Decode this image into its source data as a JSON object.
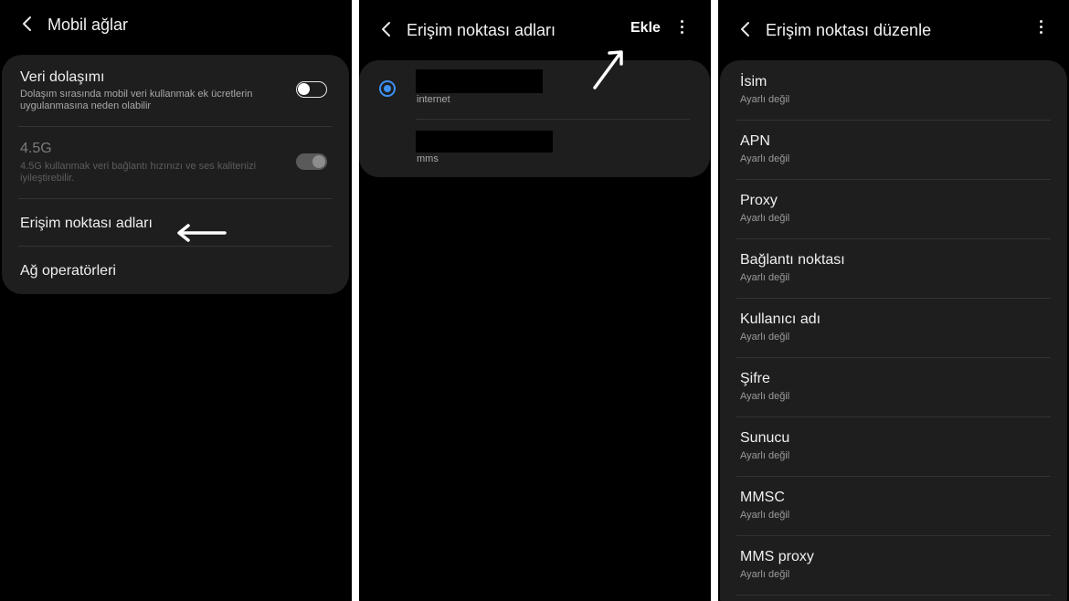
{
  "panel1": {
    "title": "Mobil ağlar",
    "rows": [
      {
        "title": "Veri dolaşımı",
        "subtitle": "Dolaşım sırasında mobil veri kullanmak ek ücretlerin uygulanmasına neden olabilir",
        "toggle": "off"
      },
      {
        "title": "4.5G",
        "subtitle": "4.5G kullanmak veri bağlantı hızınızı ve ses kalitenizi iyileştirebilir.",
        "toggle": "on-disabled"
      },
      {
        "title": "Erişim noktası adları"
      },
      {
        "title": "Ağ operatörleri"
      }
    ]
  },
  "panel2": {
    "title": "Erişim noktası adları",
    "add_label": "Ekle",
    "apns": [
      {
        "type": "internet",
        "selected": true
      },
      {
        "type": "mms",
        "selected": false
      }
    ]
  },
  "panel3": {
    "title": "Erişim noktası düzenle",
    "fields": [
      {
        "label": "İsim",
        "value": "Ayarlı değil"
      },
      {
        "label": "APN",
        "value": "Ayarlı değil"
      },
      {
        "label": "Proxy",
        "value": "Ayarlı değil"
      },
      {
        "label": "Bağlantı noktası",
        "value": "Ayarlı değil"
      },
      {
        "label": "Kullanıcı adı",
        "value": "Ayarlı değil"
      },
      {
        "label": "Şifre",
        "value": "Ayarlı değil"
      },
      {
        "label": "Sunucu",
        "value": "Ayarlı değil"
      },
      {
        "label": "MMSC",
        "value": "Ayarlı değil"
      },
      {
        "label": "MMS proxy",
        "value": "Ayarlı değil"
      }
    ]
  },
  "colors": {
    "background": "#000000",
    "card": "#1e1e1e",
    "accent": "#3e91f5",
    "annotation_arrow": "#ffffff"
  },
  "icons": [
    "back-arrow-icon",
    "more-options-icon",
    "annotation-arrow-icon"
  ]
}
